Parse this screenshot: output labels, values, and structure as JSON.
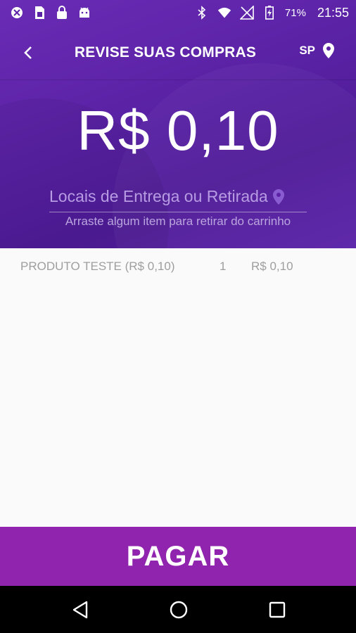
{
  "status_bar": {
    "battery": "71%",
    "time": "21:55",
    "icons": [
      "vpn-icon",
      "sim-icon",
      "lock-icon",
      "android-icon",
      "bluetooth-icon",
      "wifi-icon",
      "no-signal-icon",
      "battery-icon"
    ]
  },
  "toolbar": {
    "title": "REVISE SUAS COMPRAS",
    "region": "SP"
  },
  "summary": {
    "total": "R$ 0,10",
    "delivery_label": "Locais de Entrega ou Retirada",
    "hint": "Arraste algum item para retirar do carrinho"
  },
  "cart": {
    "items": [
      {
        "name": "PRODUTO TESTE (R$ 0,10)",
        "qty": "1",
        "price": "R$ 0,10"
      }
    ]
  },
  "action": {
    "pay_label": "PAGAR"
  },
  "colors": {
    "header": "#5b22a6",
    "pay_button": "#9124ae",
    "accent_text": "#b79be3"
  }
}
